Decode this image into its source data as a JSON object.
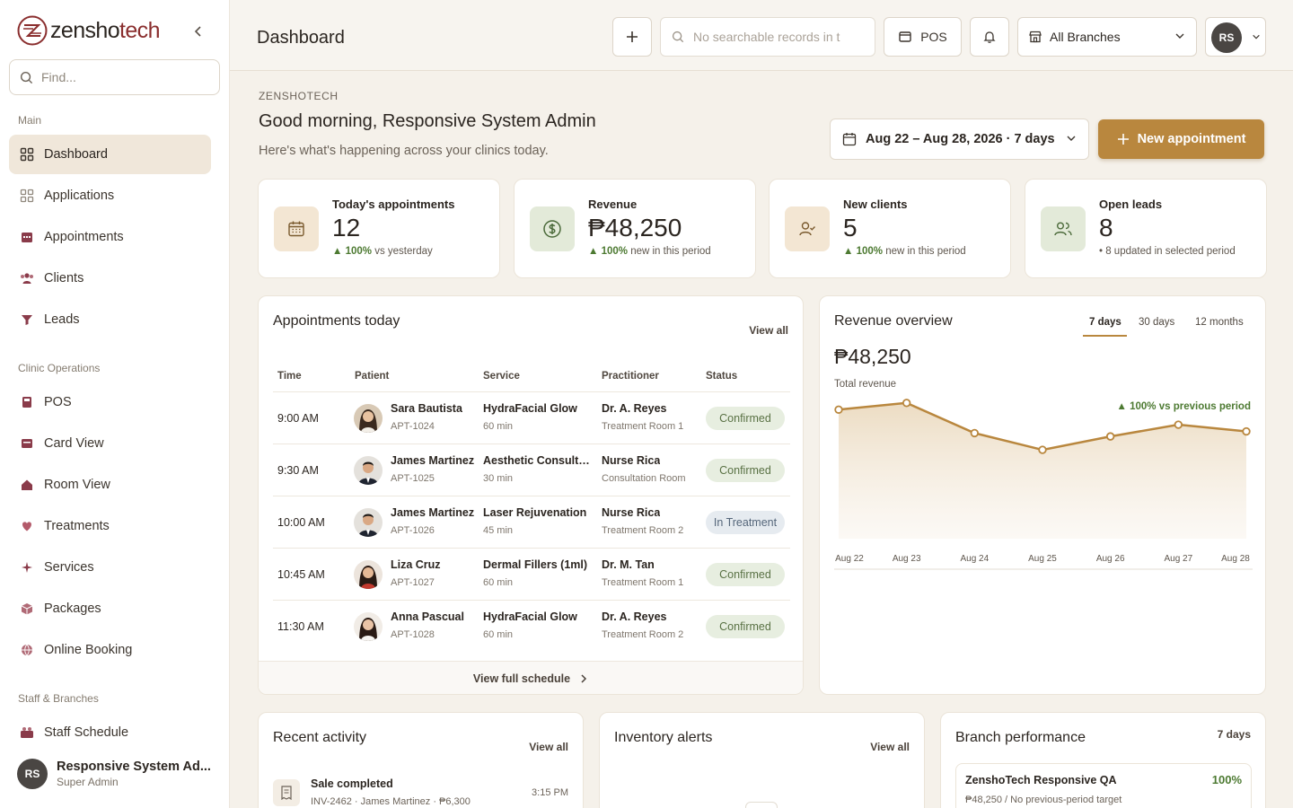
{
  "brand": {
    "name_part1": "zensho",
    "name_part2": "tech"
  },
  "sidebar": {
    "search_placeholder": "Find...",
    "sections": {
      "main": "Main",
      "clinic": "Clinic Operations",
      "staff": "Staff & Branches"
    },
    "items": [
      {
        "label": "Dashboard",
        "icon": "grid-icon"
      },
      {
        "label": "Applications",
        "icon": "apps-icon"
      },
      {
        "label": "Appointments",
        "icon": "calendar-icon"
      },
      {
        "label": "Clients",
        "icon": "users-icon"
      },
      {
        "label": "Leads",
        "icon": "funnel-icon"
      },
      {
        "label": "POS",
        "icon": "register-icon"
      },
      {
        "label": "Card View",
        "icon": "card-icon"
      },
      {
        "label": "Room View",
        "icon": "home-icon"
      },
      {
        "label": "Treatments",
        "icon": "heart-icon"
      },
      {
        "label": "Services",
        "icon": "sparkle-icon"
      },
      {
        "label": "Packages",
        "icon": "box-icon"
      },
      {
        "label": "Online Booking",
        "icon": "globe-icon"
      },
      {
        "label": "Staff Schedule",
        "icon": "staff-icon"
      }
    ],
    "user": {
      "initials": "RS",
      "name": "Responsive System Ad...",
      "role": "Super Admin"
    }
  },
  "topbar": {
    "title": "Dashboard",
    "search_placeholder": "No searchable records in t",
    "pos_label": "POS",
    "branch": "All Branches",
    "user_initials": "RS"
  },
  "greeting": {
    "eyebrow": "ZENSHOTECH",
    "title": "Good morning, Responsive System Admin",
    "subtitle": "Here's what's happening across your clinics today.",
    "date_range": "Aug 22 – Aug 28, 2026 · 7 days",
    "new_appointment": "New appointment"
  },
  "stats": [
    {
      "label": "Today's appointments",
      "value": "12",
      "change": "▲ 100%",
      "note": " vs yesterday"
    },
    {
      "label": "Revenue",
      "value": "₱48,250",
      "change": "▲ 100%",
      "note": " new in this period"
    },
    {
      "label": "New clients",
      "value": "5",
      "change": "▲ 100%",
      "note": " new in this period"
    },
    {
      "label": "Open leads",
      "value": "8",
      "change": "",
      "note": "• 8 updated in selected period"
    }
  ],
  "appointments": {
    "title": "Appointments today",
    "view_all": "View all",
    "headers": [
      "Time",
      "Patient",
      "Service",
      "Practitioner",
      "Status"
    ],
    "rows": [
      {
        "time": "9:00 AM",
        "patient": "Sara Bautista",
        "id": "APT-1024",
        "service": "HydraFacial Glow",
        "duration": "60 min",
        "practitioner": "Dr. A. Reyes",
        "room": "Treatment Room 1",
        "status": "Confirmed"
      },
      {
        "time": "9:30 AM",
        "patient": "James Martinez",
        "id": "APT-1025",
        "service": "Aesthetic Consultat...",
        "duration": "30 min",
        "practitioner": "Nurse Rica",
        "room": "Consultation Room",
        "status": "Confirmed"
      },
      {
        "time": "10:00 AM",
        "patient": "James Martinez",
        "id": "APT-1026",
        "service": "Laser Rejuvenation",
        "duration": "45 min",
        "practitioner": "Nurse Rica",
        "room": "Treatment Room 2",
        "status": "In Treatment"
      },
      {
        "time": "10:45 AM",
        "patient": "Liza Cruz",
        "id": "APT-1027",
        "service": "Dermal Fillers (1ml)",
        "duration": "60 min",
        "practitioner": "Dr. M. Tan",
        "room": "Treatment Room 1",
        "status": "Confirmed"
      },
      {
        "time": "11:30 AM",
        "patient": "Anna Pascual",
        "id": "APT-1028",
        "service": "HydraFacial Glow",
        "duration": "60 min",
        "practitioner": "Dr. A. Reyes",
        "room": "Treatment Room 2",
        "status": "Confirmed"
      }
    ],
    "footer": "View full schedule"
  },
  "revenue": {
    "title": "Revenue overview",
    "tabs": [
      "7 days",
      "30 days",
      "12 months"
    ],
    "total": "₱48,250",
    "total_label": "Total revenue",
    "change": "▲ 100% vs previous period"
  },
  "chart_data": {
    "type": "area",
    "categories": [
      "Aug 22",
      "Aug 23",
      "Aug 24",
      "Aug 25",
      "Aug 26",
      "Aug 27",
      "Aug 28"
    ],
    "values": [
      7700,
      8100,
      6300,
      5300,
      6100,
      6800,
      6400
    ],
    "ylim": [
      0,
      12000
    ],
    "grid": false,
    "color": "#b9873e"
  },
  "activity": {
    "title": "Recent activity",
    "view_all": "View all",
    "items": [
      {
        "title": "Sale completed",
        "meta": "INV-2462 · James Martinez · ₱6,300",
        "time": "3:15 PM"
      }
    ]
  },
  "inventory": {
    "title": "Inventory alerts",
    "view_all": "View all"
  },
  "branch_perf": {
    "title": "Branch performance",
    "period": "7 days",
    "branches": [
      {
        "name": "ZenshoTech Responsive QA",
        "pct": "100%",
        "meta": "₱48,250 / No previous-period target"
      }
    ]
  },
  "colors": {
    "accent": "#b9873e",
    "brand": "#8a2e2e",
    "positive": "#4d7a32"
  }
}
